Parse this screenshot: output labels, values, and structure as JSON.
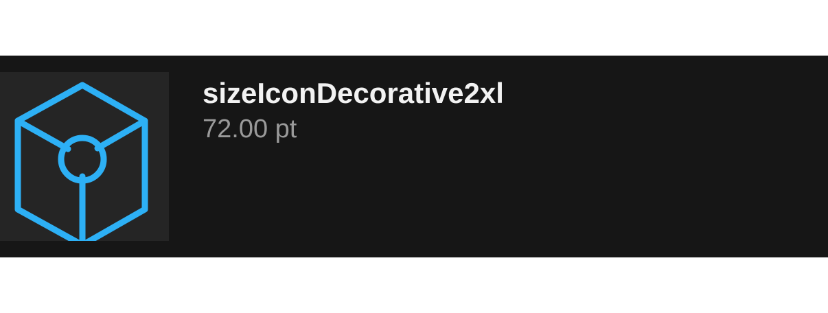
{
  "token": {
    "name": "sizeIconDecorative2xl",
    "value": "72.00 pt",
    "icon": "cube-icon",
    "icon_color": "#2db0f5"
  },
  "colors": {
    "row_background": "#161616",
    "tile_background": "#252525",
    "name_text": "#f2f2f2",
    "value_text": "#9a9a9a"
  }
}
